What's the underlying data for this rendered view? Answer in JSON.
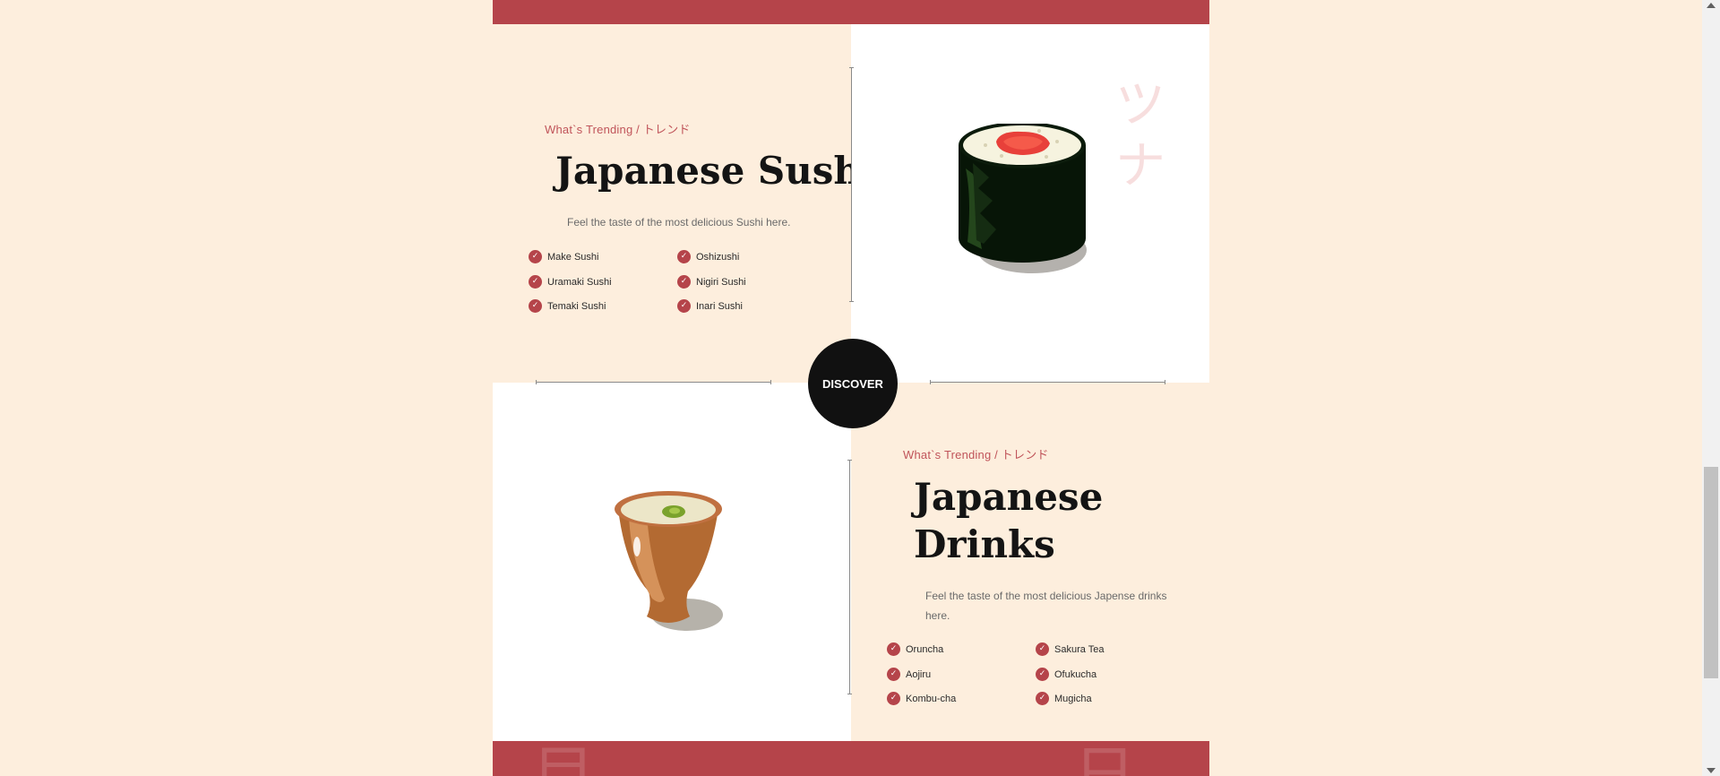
{
  "sections": [
    {
      "kicker": "What`s Trending / トレンド",
      "title": "Japanese Sushi",
      "description": "Feel the taste of the most delicious Sushi here.",
      "features": [
        "Make Sushi",
        "Oshizushi",
        "Uramaki Sushi",
        "Nigiri Sushi",
        "Temaki Sushi",
        "Inari Sushi"
      ],
      "image_icon": "sushi-roll-icon"
    },
    {
      "kicker": "What`s Trending / トレンド",
      "title_line1": "Japanese",
      "title_line2": "Drinks",
      "description_line1": "Feel the taste of the most delicious Japense drinks",
      "description_line2": "here.",
      "features": [
        "Oruncha",
        "Sakura Tea",
        "Aojiru",
        "Ofukucha",
        "Kombu-cha",
        "Mugicha"
      ],
      "image_icon": "tea-cup-icon"
    }
  ],
  "decorative_kana": [
    "ツ",
    "ナ"
  ],
  "discover_button": "DISCOVER",
  "check_icon": "✓",
  "colors": {
    "accent": "#b5444a",
    "cream": "#fdeedd",
    "dark": "#111111"
  }
}
